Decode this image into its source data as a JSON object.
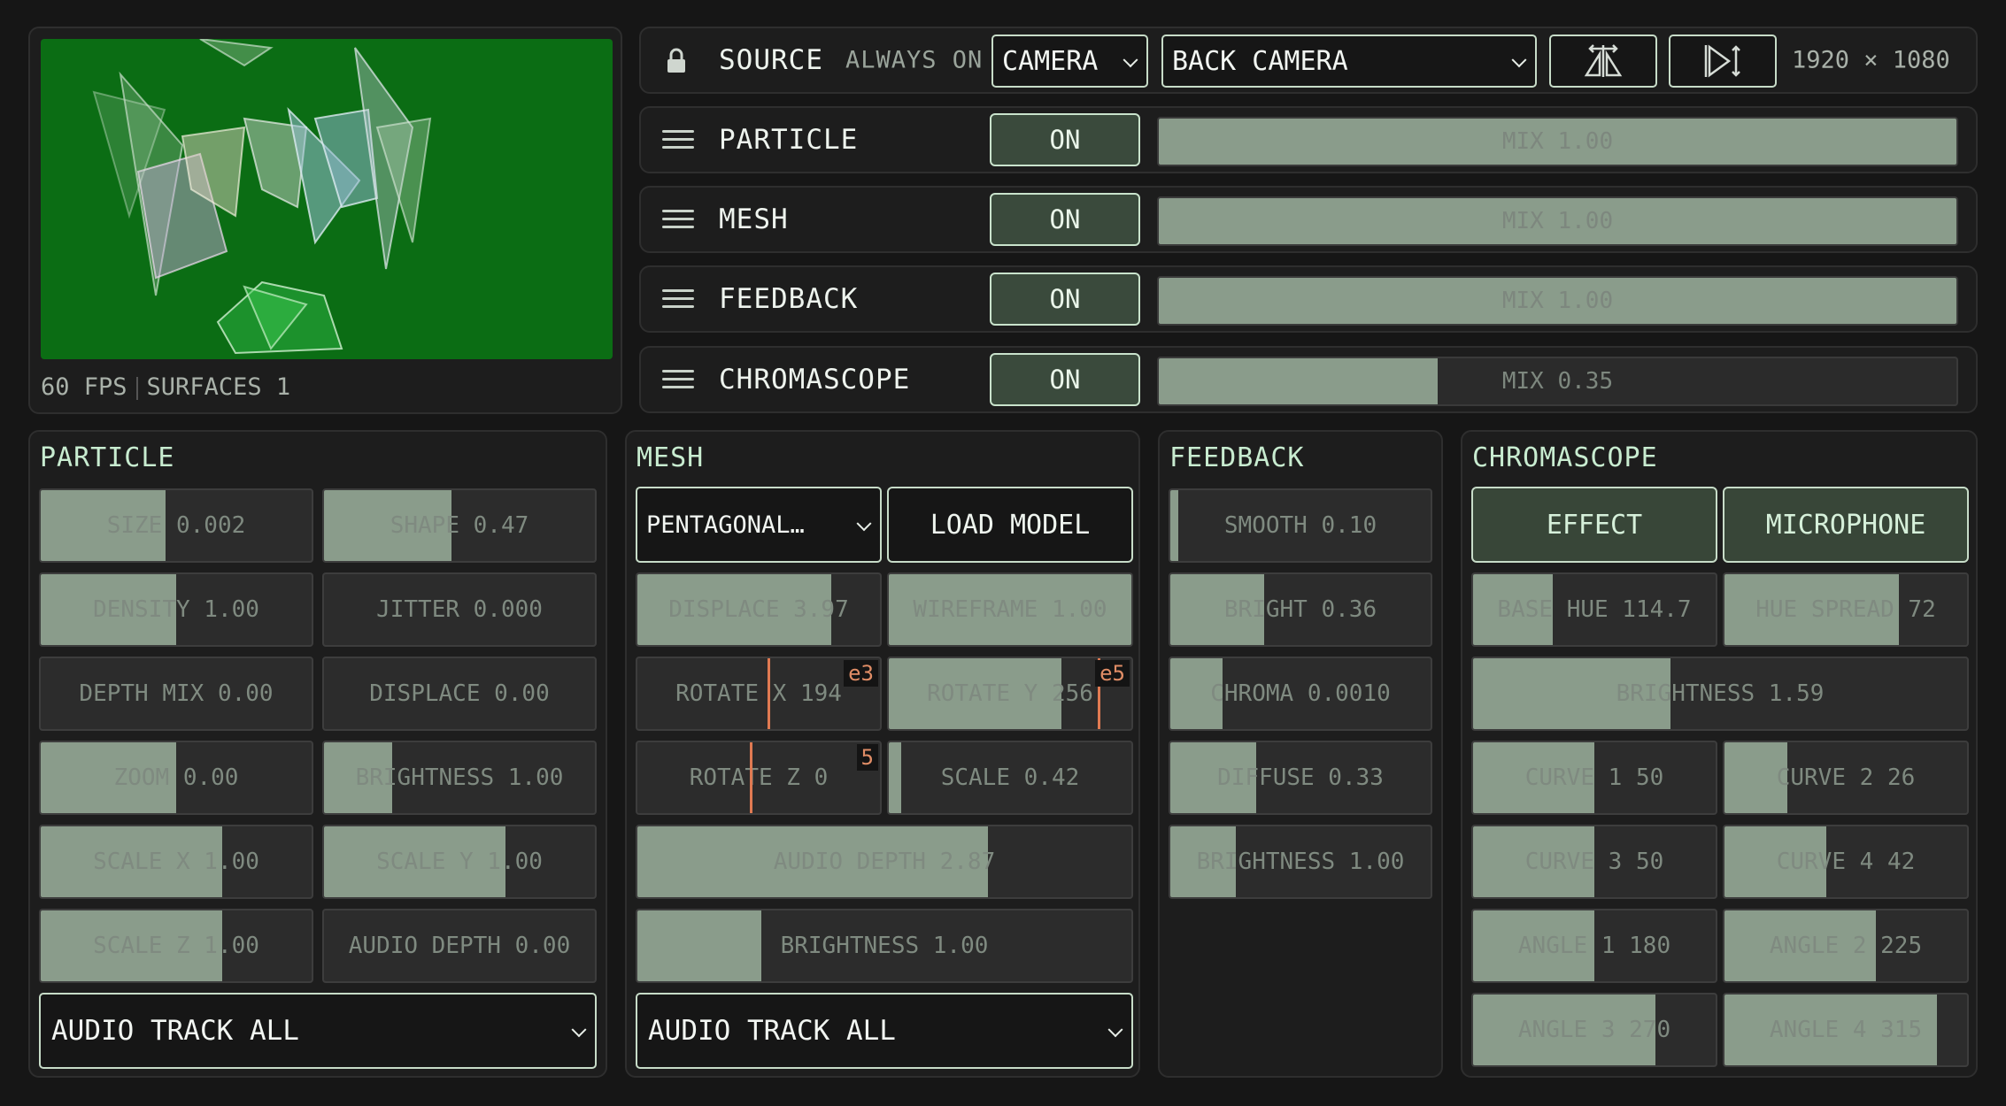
{
  "preview": {
    "fps": "60 FPS",
    "surfaces": "SURFACES 1"
  },
  "source": {
    "label": "SOURCE",
    "mode": "ALWAYS ON",
    "type_value": "CAMERA",
    "camera_value": "BACK CAMERA",
    "resolution": "1920 × 1080",
    "lock_icon": "lock-icon",
    "flip_h_icon": "flip-horizontal-icon",
    "flip_v_icon": "flip-vertical-icon"
  },
  "layers": [
    {
      "name": "PARTICLE",
      "toggle": "ON",
      "mix_label": "MIX 1.00",
      "mix": 1.0
    },
    {
      "name": "MESH",
      "toggle": "ON",
      "mix_label": "MIX 1.00",
      "mix": 1.0
    },
    {
      "name": "FEEDBACK",
      "toggle": "ON",
      "mix_label": "MIX 1.00",
      "mix": 1.0
    },
    {
      "name": "CHROMASCOPE",
      "toggle": "ON",
      "mix_label": "MIX 0.35",
      "mix": 0.35
    }
  ],
  "particle": {
    "title": "PARTICLE",
    "sliders": [
      {
        "label": "SIZE 0.002",
        "fill": 0.46
      },
      {
        "label": "SHAPE 0.47",
        "fill": 0.47
      },
      {
        "label": "DENSITY 1.00",
        "fill": 0.5
      },
      {
        "label": "JITTER 0.000",
        "fill": 0
      },
      {
        "label": "DEPTH MIX 0.00",
        "fill": 0
      },
      {
        "label": "DISPLACE 0.00",
        "fill": 0
      },
      {
        "label": "ZOOM 0.00",
        "fill": 0.5
      },
      {
        "label": "BRIGHTNESS 1.00",
        "fill": 0.25
      },
      {
        "label": "SCALE X 1.00",
        "fill": 0.67
      },
      {
        "label": "SCALE Y 1.00",
        "fill": 0.67
      },
      {
        "label": "SCALE Z 1.00",
        "fill": 0.67
      },
      {
        "label": "AUDIO DEPTH 0.00",
        "fill": 0
      }
    ],
    "audio_track": "AUDIO TRACK ALL"
  },
  "mesh": {
    "title": "MESH",
    "model_value": "PENTAGONAL…",
    "load_label": "LOAD MODEL",
    "displace": {
      "label": "DISPLACE 3.97",
      "fill": 0.8
    },
    "wireframe": {
      "label": "WIREFRAME 1.00",
      "fill": 1.0
    },
    "rotate_x": {
      "label": "ROTATE X 194",
      "badge": "e3",
      "value": 194
    },
    "rotate_y": {
      "label": "ROTATE Y 256",
      "badge": "e5",
      "value": 256,
      "fill": 0.71
    },
    "rotate_z": {
      "label": "ROTATE Z 0",
      "badge": "5",
      "value": 0
    },
    "scale": {
      "label": "SCALE 0.42",
      "fill": 0.05
    },
    "audio_depth": {
      "label": "AUDIO DEPTH 2.87",
      "fill": 0.71
    },
    "brightness": {
      "label": "BRIGHTNESS 1.00",
      "fill": 0.25
    },
    "audio_track": "AUDIO TRACK ALL"
  },
  "feedback": {
    "title": "FEEDBACK",
    "sliders": [
      {
        "label": "SMOOTH 0.10",
        "fill": 0.03
      },
      {
        "label": "BRIGHT 0.36",
        "fill": 0.36
      },
      {
        "label": "CHROMA 0.0010",
        "fill": 0.2
      },
      {
        "label": "DIFFUSE 0.33",
        "fill": 0.33
      },
      {
        "label": "BRIGHTNESS 1.00",
        "fill": 0.25
      }
    ]
  },
  "chromascope": {
    "title": "CHROMASCOPE",
    "effect_label": "EFFECT",
    "microphone_label": "MICROPHONE",
    "base_hue": {
      "label": "BASE HUE 114.7",
      "fill": 0.33
    },
    "hue_spread": {
      "label": "HUE SPREAD 72",
      "fill": 0.72
    },
    "brightness": {
      "label": "BRIGHTNESS 1.59",
      "fill": 0.4
    },
    "curves": [
      {
        "label": "CURVE 1 50",
        "fill": 0.5
      },
      {
        "label": "CURVE 2 26",
        "fill": 0.26
      },
      {
        "label": "CURVE 3 50",
        "fill": 0.5
      },
      {
        "label": "CURVE 4 42",
        "fill": 0.42
      }
    ],
    "angles": [
      {
        "label": "ANGLE 1 180",
        "fill": 0.5
      },
      {
        "label": "ANGLE 2 225",
        "fill": 0.625
      },
      {
        "label": "ANGLE 3 270",
        "fill": 0.75
      },
      {
        "label": "ANGLE 4 315",
        "fill": 0.875
      }
    ]
  }
}
